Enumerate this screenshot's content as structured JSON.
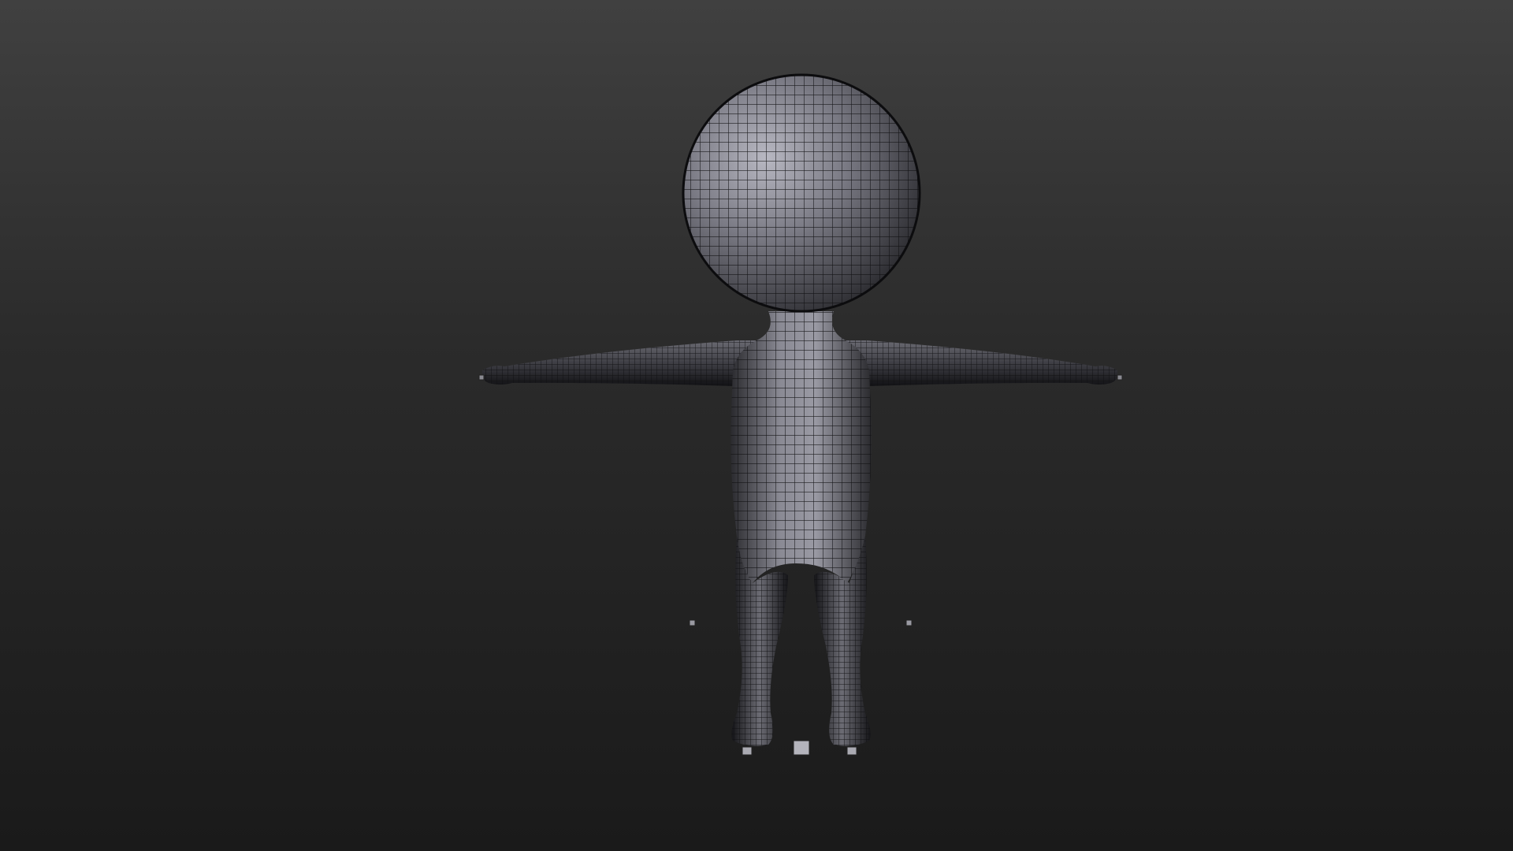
{
  "viewport": {
    "background_top": "#404040",
    "background_bottom": "#1a1a1a"
  },
  "model": {
    "object": "character-mesh",
    "display": "wireframe-on-shaded",
    "pose": "T-pose",
    "surface_color": "#8a8a92",
    "wire_color": "#111111"
  },
  "gizmos": [
    "left-hand-handle",
    "right-hand-handle",
    "left-knee-handle",
    "right-knee-handle",
    "left-foot-handle",
    "right-foot-handle",
    "root-handle"
  ]
}
